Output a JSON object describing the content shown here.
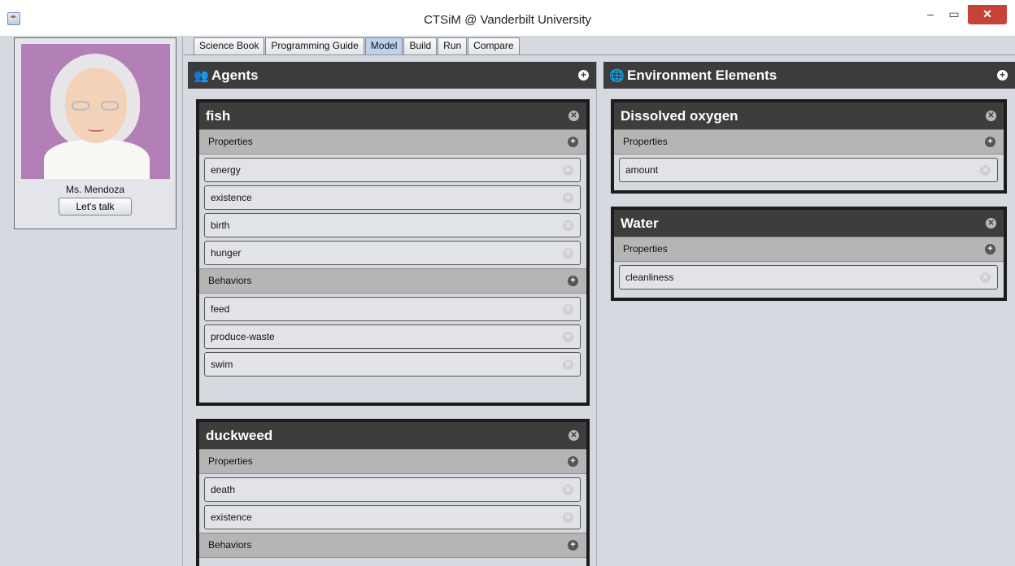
{
  "window": {
    "title": "CTSiM @ Vanderbilt University",
    "min_glyph": "–",
    "max_glyph": "▭",
    "close_glyph": "✕"
  },
  "sidebar": {
    "mentor_name": "Ms. Mendoza",
    "talk_button": "Let's talk"
  },
  "tabs": [
    {
      "label": "Science Book"
    },
    {
      "label": "Programming Guide"
    },
    {
      "label": "Model",
      "active": true
    },
    {
      "label": "Build"
    },
    {
      "label": "Run"
    },
    {
      "label": "Compare"
    }
  ],
  "agents_panel": {
    "title": "Agents",
    "icon": "users-icon",
    "agents": [
      {
        "name": "fish",
        "properties_label": "Properties",
        "properties": [
          "energy",
          "existence",
          "birth",
          "hunger"
        ],
        "behaviors_label": "Behaviors",
        "behaviors": [
          "feed",
          "produce-waste",
          "swim"
        ]
      },
      {
        "name": "duckweed",
        "properties_label": "Properties",
        "properties": [
          "death",
          "existence"
        ],
        "behaviors_label": "Behaviors",
        "behaviors": []
      }
    ]
  },
  "environment_panel": {
    "title": "Environment Elements",
    "icon": "globe-icon",
    "elements": [
      {
        "name": "Dissolved oxygen",
        "properties_label": "Properties",
        "properties": [
          "amount"
        ]
      },
      {
        "name": "Water",
        "properties_label": "Properties",
        "properties": [
          "cleanliness"
        ]
      }
    ]
  },
  "colors": {
    "panel_header": "#3c3c3c",
    "section_bar": "#b5b5b5",
    "background": "#d6d9e0",
    "active_tab": "#bcd1ea",
    "close_button": "#c7433a"
  }
}
